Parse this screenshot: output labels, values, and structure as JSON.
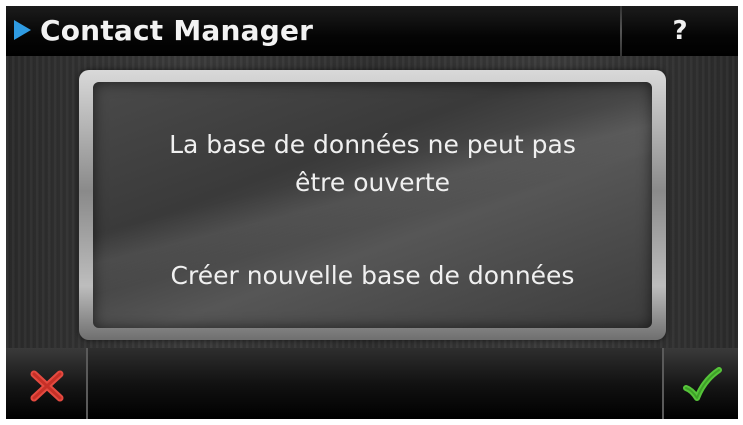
{
  "header": {
    "title": "Contact Manager",
    "help_label": "?"
  },
  "dialog": {
    "message_line1": "La base de données ne peut pas",
    "message_line2": "être ouverte",
    "action_label": "Créer nouvelle base de données"
  },
  "footer": {
    "cancel_icon": "cancel-x-icon",
    "confirm_icon": "checkmark-icon"
  },
  "colors": {
    "title_arrow": "#2f9be2",
    "cancel_red": "#d9332b",
    "confirm_green": "#3fae2a"
  }
}
